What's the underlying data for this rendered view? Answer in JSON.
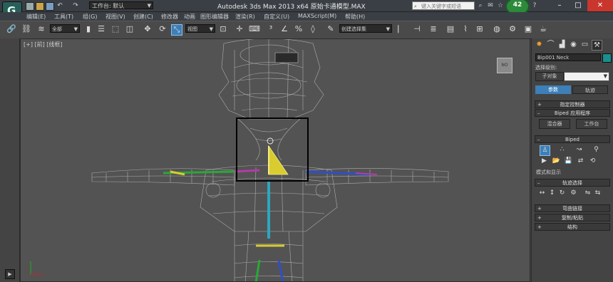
{
  "titlebar": {
    "app_logo_letter": "G",
    "workspace_label": "工作台: 默认",
    "window_title": "Autodesk 3ds Max  2013 x64      原始卡通模型.MAX",
    "search_placeholder": "键入关键字或短语",
    "notification_count": "42"
  },
  "menu": {
    "items": [
      "编辑(E)",
      "工具(T)",
      "组(G)",
      "视图(V)",
      "创建(C)",
      "修改器",
      "动画",
      "图形编辑器",
      "渲染(R)",
      "自定义(U)",
      "MAXScript(M)",
      "帮助(H)"
    ]
  },
  "toolbar": {
    "selection_filter": "全部",
    "ref_coord": "视图",
    "named_selection": "创建选择集"
  },
  "viewport": {
    "label": "[+] [前] [线框]",
    "viewcube_label": "NO"
  },
  "command_panel": {
    "object_name": "Bip001 Neck",
    "selection_level_label": "选择级别:",
    "sub_object_label": "子对象",
    "tabs": {
      "params": "参数",
      "trajectory": "轨迹"
    },
    "rollouts": {
      "assign_controller": "指定控制器",
      "biped_apps": "Biped 应用程序",
      "biped": "Biped",
      "track_selection": "轨迹选择",
      "bend_links": "弯曲链接",
      "copy_paste": "复制/粘贴",
      "structure": "结构"
    },
    "buttons": {
      "mixer": "混合器",
      "workbench": "工作台"
    },
    "mode_display_label": "模式和显示"
  },
  "colors": {
    "accent_blue": "#3d7fb8",
    "wireframe": "#c4c4c4",
    "bone_yellow": "#d8cc30",
    "object_color": "#1a8f8f"
  }
}
